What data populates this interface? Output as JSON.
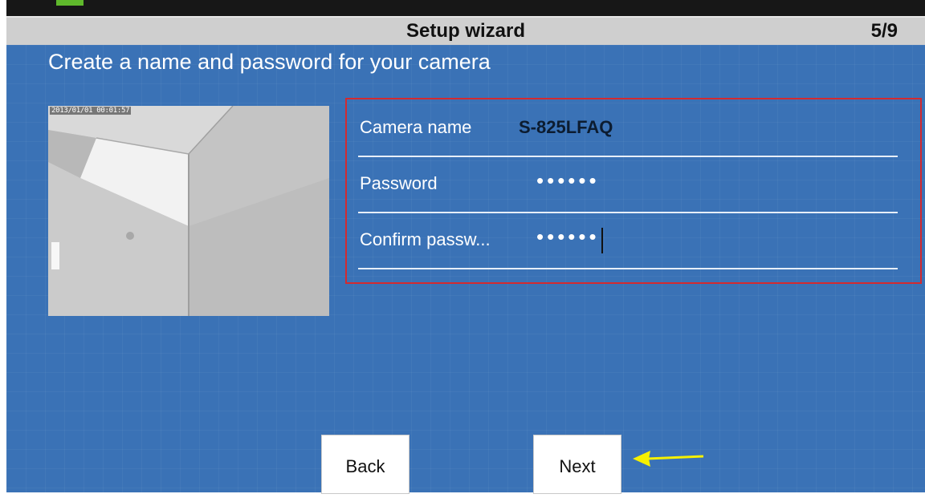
{
  "header": {
    "title": "Setup wizard",
    "step": "5/9"
  },
  "main": {
    "heading": "Create a name and password for your camera",
    "preview": {
      "timestamp": "2013/01/01 00:01:57"
    },
    "form": {
      "camera_name": {
        "label": "Camera name",
        "value": "S-825LFAQ"
      },
      "password": {
        "label": "Password",
        "masked_value": "••••••"
      },
      "confirm_password": {
        "label": "Confirm passw...",
        "masked_value": "••••••"
      }
    },
    "buttons": {
      "back_label": "Back",
      "next_label": "Next"
    }
  },
  "colors": {
    "background": "#3a72b6",
    "header": "#cfcfcf",
    "highlight_border": "#d32a2f",
    "annotation_arrow": "#f5f000"
  },
  "icons": [
    "annotation-arrow-icon"
  ]
}
